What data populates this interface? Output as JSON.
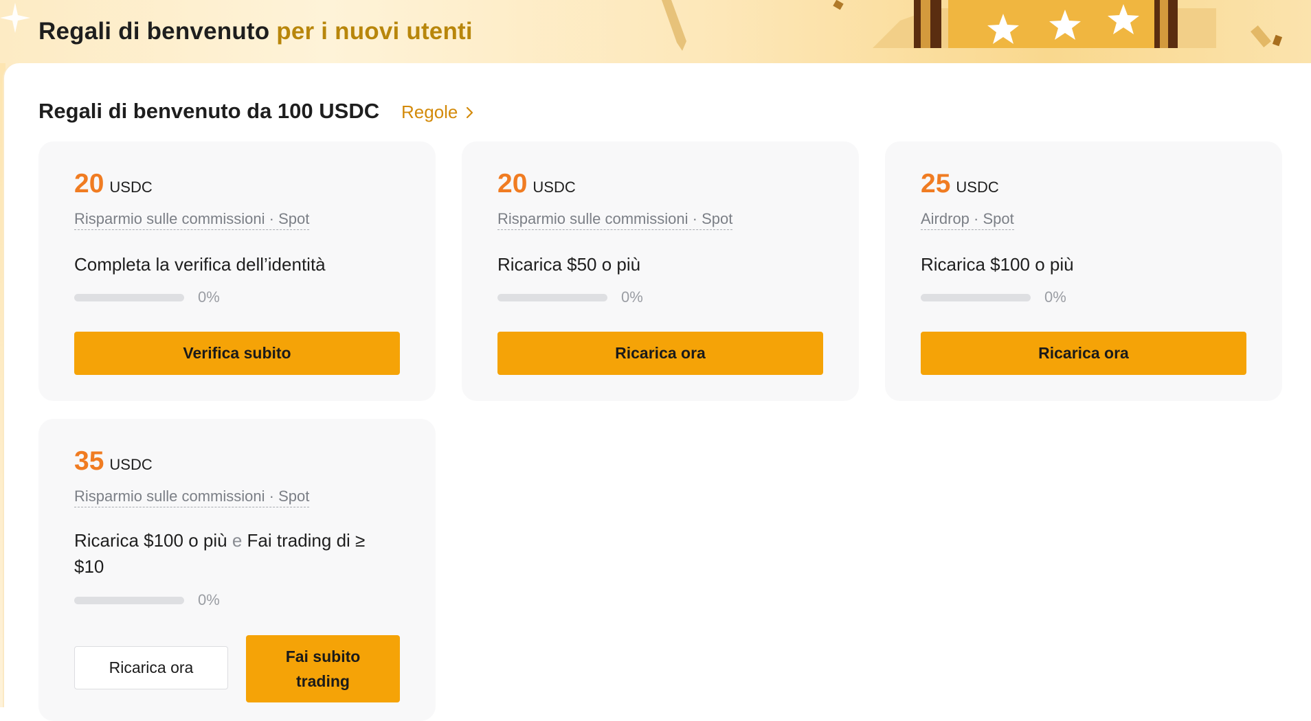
{
  "banner": {
    "title_main": "Regali di benvenuto",
    "title_highlight": "per i nuovi utenti"
  },
  "section": {
    "title": "Regali di benvenuto da 100 USDC",
    "rules_label": "Regole"
  },
  "colors": {
    "accent": "#f5a307",
    "amount": "#f07c22",
    "link": "#d38a0a"
  },
  "cards": [
    {
      "amount": "20",
      "unit": "USDC",
      "tag": "Risparmio sulle commissioni · Spot",
      "task": "Completa la verifica dell’identità",
      "progress_percent": 0,
      "progress_label": "0%",
      "primary_button": "Verifica subito"
    },
    {
      "amount": "20",
      "unit": "USDC",
      "tag": "Risparmio sulle commissioni · Spot",
      "task": "Ricarica $50 o più",
      "progress_percent": 0,
      "progress_label": "0%",
      "primary_button": "Ricarica ora"
    },
    {
      "amount": "25",
      "unit": "USDC",
      "tag": "Airdrop · Spot",
      "task": "Ricarica $100 o più",
      "progress_percent": 0,
      "progress_label": "0%",
      "primary_button": "Ricarica ora"
    },
    {
      "amount": "35",
      "unit": "USDC",
      "tag": "Risparmio sulle commissioni · Spot",
      "task_part1": "Ricarica $100 o più",
      "task_conj": "e",
      "task_part2": "Fai trading di ≥ $10",
      "progress_percent": 0,
      "progress_label": "0%",
      "secondary_button": "Ricarica ora",
      "primary_button": "Fai subito trading"
    }
  ]
}
